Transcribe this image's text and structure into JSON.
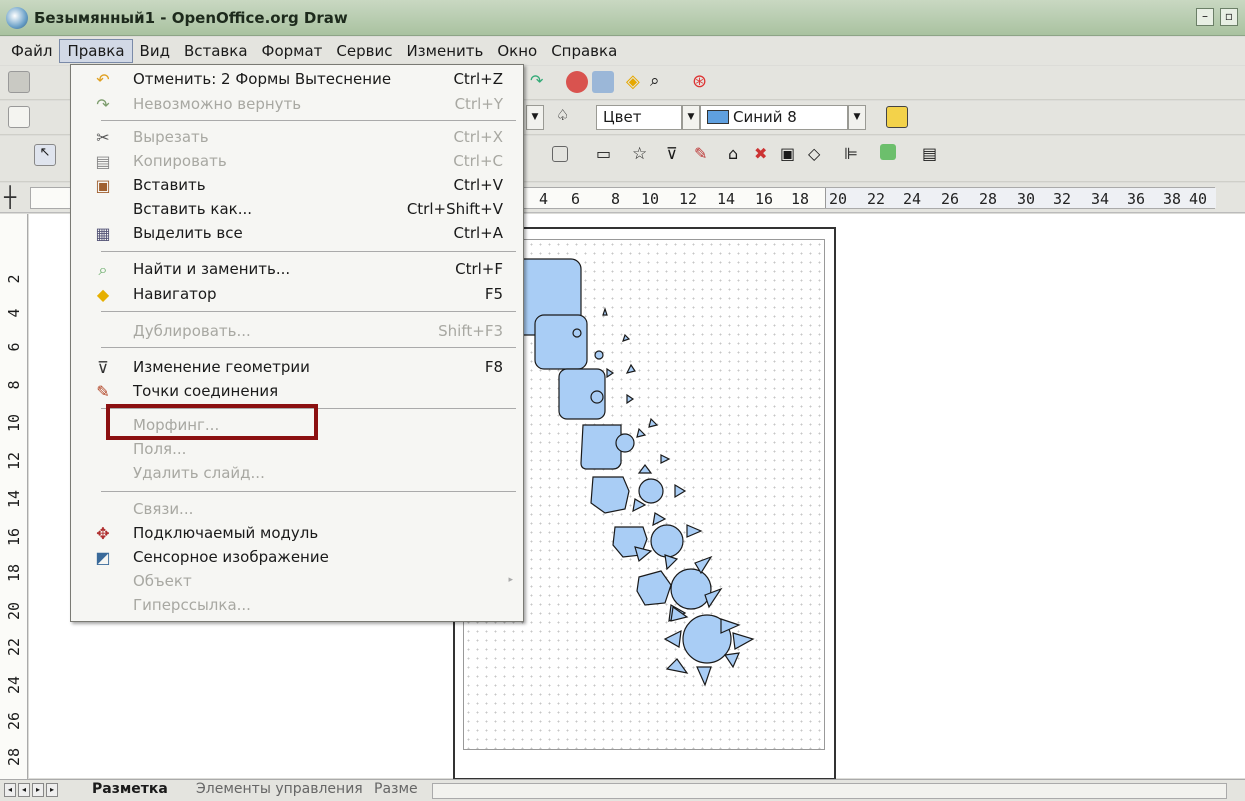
{
  "window": {
    "title": "Безымянный1 - OpenOffice.org Draw"
  },
  "menubar": [
    "Файл",
    "Правка",
    "Вид",
    "Вставка",
    "Формат",
    "Сервис",
    "Изменить",
    "Окно",
    "Справка"
  ],
  "toolbar2": {
    "color_mode": "Цвет",
    "fill_color": "Синий 8",
    "fill_swatch": "#5fa0e0"
  },
  "ruler_h": [
    "4",
    "6",
    "8",
    "10",
    "12",
    "14",
    "16",
    "18",
    "20",
    "22",
    "24",
    "26",
    "28",
    "30",
    "32",
    "34",
    "36",
    "38",
    "40"
  ],
  "ruler_v": [
    "2",
    "4",
    "6",
    "8",
    "10",
    "12",
    "14",
    "16",
    "18",
    "20",
    "22",
    "24",
    "26",
    "28"
  ],
  "edit_menu": {
    "items": [
      {
        "label": "Отменить: 2 Формы Вытеснение",
        "shortcut": "Ctrl+Z",
        "icon": "undo-icon",
        "disabled": false
      },
      {
        "label": "Невозможно вернуть",
        "shortcut": "Ctrl+Y",
        "icon": "redo-icon",
        "disabled": true
      },
      {
        "label": "Вырезать",
        "shortcut": "Ctrl+X",
        "icon": "scissors-icon",
        "disabled": true
      },
      {
        "label": "Копировать",
        "shortcut": "Ctrl+C",
        "icon": "copy-icon",
        "disabled": true
      },
      {
        "label": "Вставить",
        "shortcut": "Ctrl+V",
        "icon": "paste-icon",
        "disabled": false
      },
      {
        "label": "Вставить как...",
        "shortcut": "Ctrl+Shift+V",
        "icon": "",
        "disabled": false
      },
      {
        "label": "Выделить все",
        "shortcut": "Ctrl+A",
        "icon": "select-all-icon",
        "disabled": false
      },
      {
        "label": "Найти и заменить...",
        "shortcut": "Ctrl+F",
        "icon": "find-replace-icon",
        "disabled": false
      },
      {
        "label": "Навигатор",
        "shortcut": "F5",
        "icon": "navigator-icon",
        "disabled": false
      },
      {
        "label": "Дублировать...",
        "shortcut": "Shift+F3",
        "icon": "",
        "disabled": true
      },
      {
        "label": "Изменение геометрии",
        "shortcut": "F8",
        "icon": "points-icon",
        "disabled": false
      },
      {
        "label": "Точки соединения",
        "shortcut": "",
        "icon": "glue-points-icon",
        "disabled": false
      },
      {
        "label": "Морфинг...",
        "shortcut": "",
        "icon": "",
        "disabled": true
      },
      {
        "label": "Поля...",
        "shortcut": "",
        "icon": "",
        "disabled": true
      },
      {
        "label": "Удалить слайд...",
        "shortcut": "",
        "icon": "",
        "disabled": true
      },
      {
        "label": "Связи...",
        "shortcut": "",
        "icon": "",
        "disabled": true
      },
      {
        "label": "Подключаемый модуль",
        "shortcut": "",
        "icon": "plugin-icon",
        "disabled": false
      },
      {
        "label": "Сенсорное изображение",
        "shortcut": "",
        "icon": "image-map-icon",
        "disabled": false
      },
      {
        "label": "Объект",
        "shortcut": "",
        "icon": "",
        "disabled": true
      },
      {
        "label": "Гиперссылка...",
        "shortcut": "",
        "icon": "",
        "disabled": true
      }
    ]
  },
  "tabs": {
    "active": "Разметка",
    "second": "Элементы управления",
    "third": "Разме"
  },
  "shape_color": "#a9cdf5"
}
